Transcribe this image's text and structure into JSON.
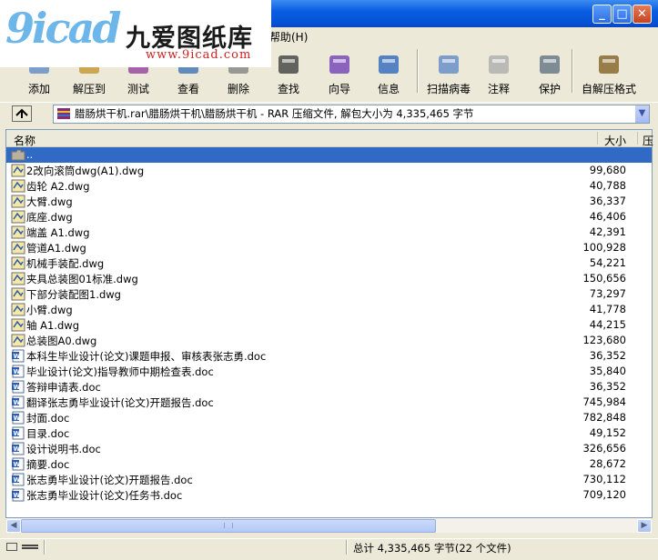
{
  "logo": {
    "text": "9icad",
    "cn": "九爱图纸库",
    "url": "www.9icad.com"
  },
  "menu": {
    "help": "帮助(H)"
  },
  "toolbar": [
    {
      "label": "添加",
      "icon": "add-icon"
    },
    {
      "label": "解压到",
      "icon": "extract-to-icon"
    },
    {
      "label": "测试",
      "icon": "test-icon"
    },
    {
      "label": "查看",
      "icon": "view-icon"
    },
    {
      "label": "删除",
      "icon": "delete-icon"
    },
    {
      "label": "查找",
      "icon": "find-icon"
    },
    {
      "label": "向导",
      "icon": "wizard-icon"
    },
    {
      "label": "信息",
      "icon": "info-icon"
    },
    {
      "label": "扫描病毒",
      "icon": "virus-scan-icon"
    },
    {
      "label": "注释",
      "icon": "comment-icon"
    },
    {
      "label": "保护",
      "icon": "protect-icon"
    },
    {
      "label": "自解压格式",
      "icon": "sfx-icon"
    }
  ],
  "address": {
    "path": "腊肠烘干机.rar\\腊肠烘干机\\腊肠烘干机 - RAR 压缩文件, 解包大小为 4,335,465 字节"
  },
  "columns": {
    "name": "名称",
    "size": "大小",
    "packed": "压"
  },
  "files": [
    {
      "name": "..",
      "size": "",
      "type": "folder",
      "selected": true
    },
    {
      "name": "2改向滚筒dwg(A1).dwg",
      "size": "99,680",
      "type": "dwg"
    },
    {
      "name": "齿轮 A2.dwg",
      "size": "40,788",
      "type": "dwg"
    },
    {
      "name": "大臂.dwg",
      "size": "36,337",
      "type": "dwg"
    },
    {
      "name": "底座.dwg",
      "size": "46,406",
      "type": "dwg"
    },
    {
      "name": "端盖 A1.dwg",
      "size": "42,391",
      "type": "dwg"
    },
    {
      "name": "管道A1.dwg",
      "size": "100,928",
      "type": "dwg"
    },
    {
      "name": "机械手装配.dwg",
      "size": "54,221",
      "type": "dwg"
    },
    {
      "name": "夹具总装图01标准.dwg",
      "size": "150,656",
      "type": "dwg"
    },
    {
      "name": "下部分装配图1.dwg",
      "size": "73,297",
      "type": "dwg"
    },
    {
      "name": "小臂.dwg",
      "size": "41,778",
      "type": "dwg"
    },
    {
      "name": "轴 A1.dwg",
      "size": "44,215",
      "type": "dwg"
    },
    {
      "name": "总装图A0.dwg",
      "size": "123,680",
      "type": "dwg"
    },
    {
      "name": "本科生毕业设计(论文)课题申报、审核表张志勇.doc",
      "size": "36,352",
      "type": "doc"
    },
    {
      "name": "毕业设计(论文)指导教师中期检查表.doc",
      "size": "35,840",
      "type": "doc"
    },
    {
      "name": "答辩申请表.doc",
      "size": "36,352",
      "type": "doc"
    },
    {
      "name": "翻译张志勇毕业设计(论文)开题报告.doc",
      "size": "745,984",
      "type": "doc"
    },
    {
      "name": "封面.doc",
      "size": "782,848",
      "type": "doc"
    },
    {
      "name": "目录.doc",
      "size": "49,152",
      "type": "doc"
    },
    {
      "name": "设计说明书.doc",
      "size": "326,656",
      "type": "doc"
    },
    {
      "name": "摘要.doc",
      "size": "28,672",
      "type": "doc"
    },
    {
      "name": "张志勇毕业设计(论文)开题报告.doc",
      "size": "730,112",
      "type": "doc"
    },
    {
      "name": "张志勇毕业设计(论文)任务书.doc",
      "size": "709,120",
      "type": "doc"
    }
  ],
  "status": {
    "summary": "总计 4,335,465 字节(22 个文件)"
  },
  "colors": {
    "titlebar": "#0a5ee0",
    "selection": "#316ac5",
    "face": "#ece9d8"
  }
}
